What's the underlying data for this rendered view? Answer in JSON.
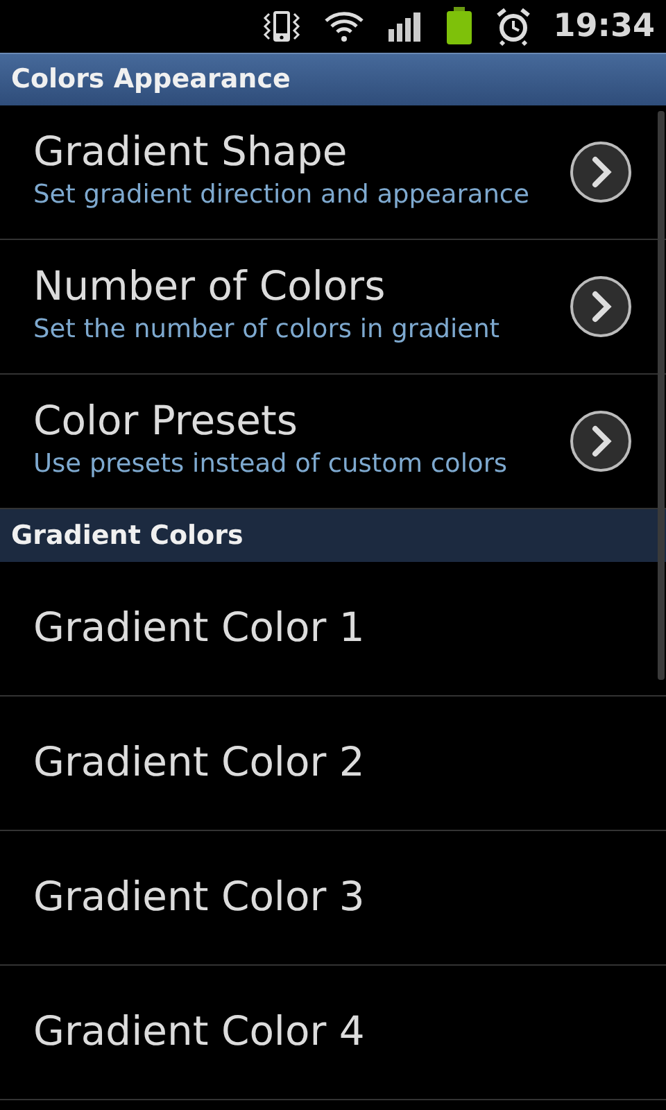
{
  "status_bar": {
    "time": "19:34"
  },
  "sections": [
    {
      "title": "Colors Appearance",
      "kind": "top",
      "items": [
        {
          "title": "Gradient Shape",
          "summary": "Set gradient direction and appearance",
          "kind": "nav"
        },
        {
          "title": "Number of Colors",
          "summary": "Set the number of colors in gradient",
          "kind": "nav"
        },
        {
          "title": "Color Presets",
          "summary": "Use presets instead of custom colors",
          "kind": "nav"
        }
      ]
    },
    {
      "title": "Gradient Colors",
      "kind": "sub",
      "items": [
        {
          "title": "Gradient Color 1",
          "kind": "plain"
        },
        {
          "title": "Gradient Color 2",
          "kind": "plain"
        },
        {
          "title": "Gradient Color 3",
          "kind": "plain"
        },
        {
          "title": "Gradient Color 4",
          "kind": "plain"
        }
      ]
    }
  ]
}
